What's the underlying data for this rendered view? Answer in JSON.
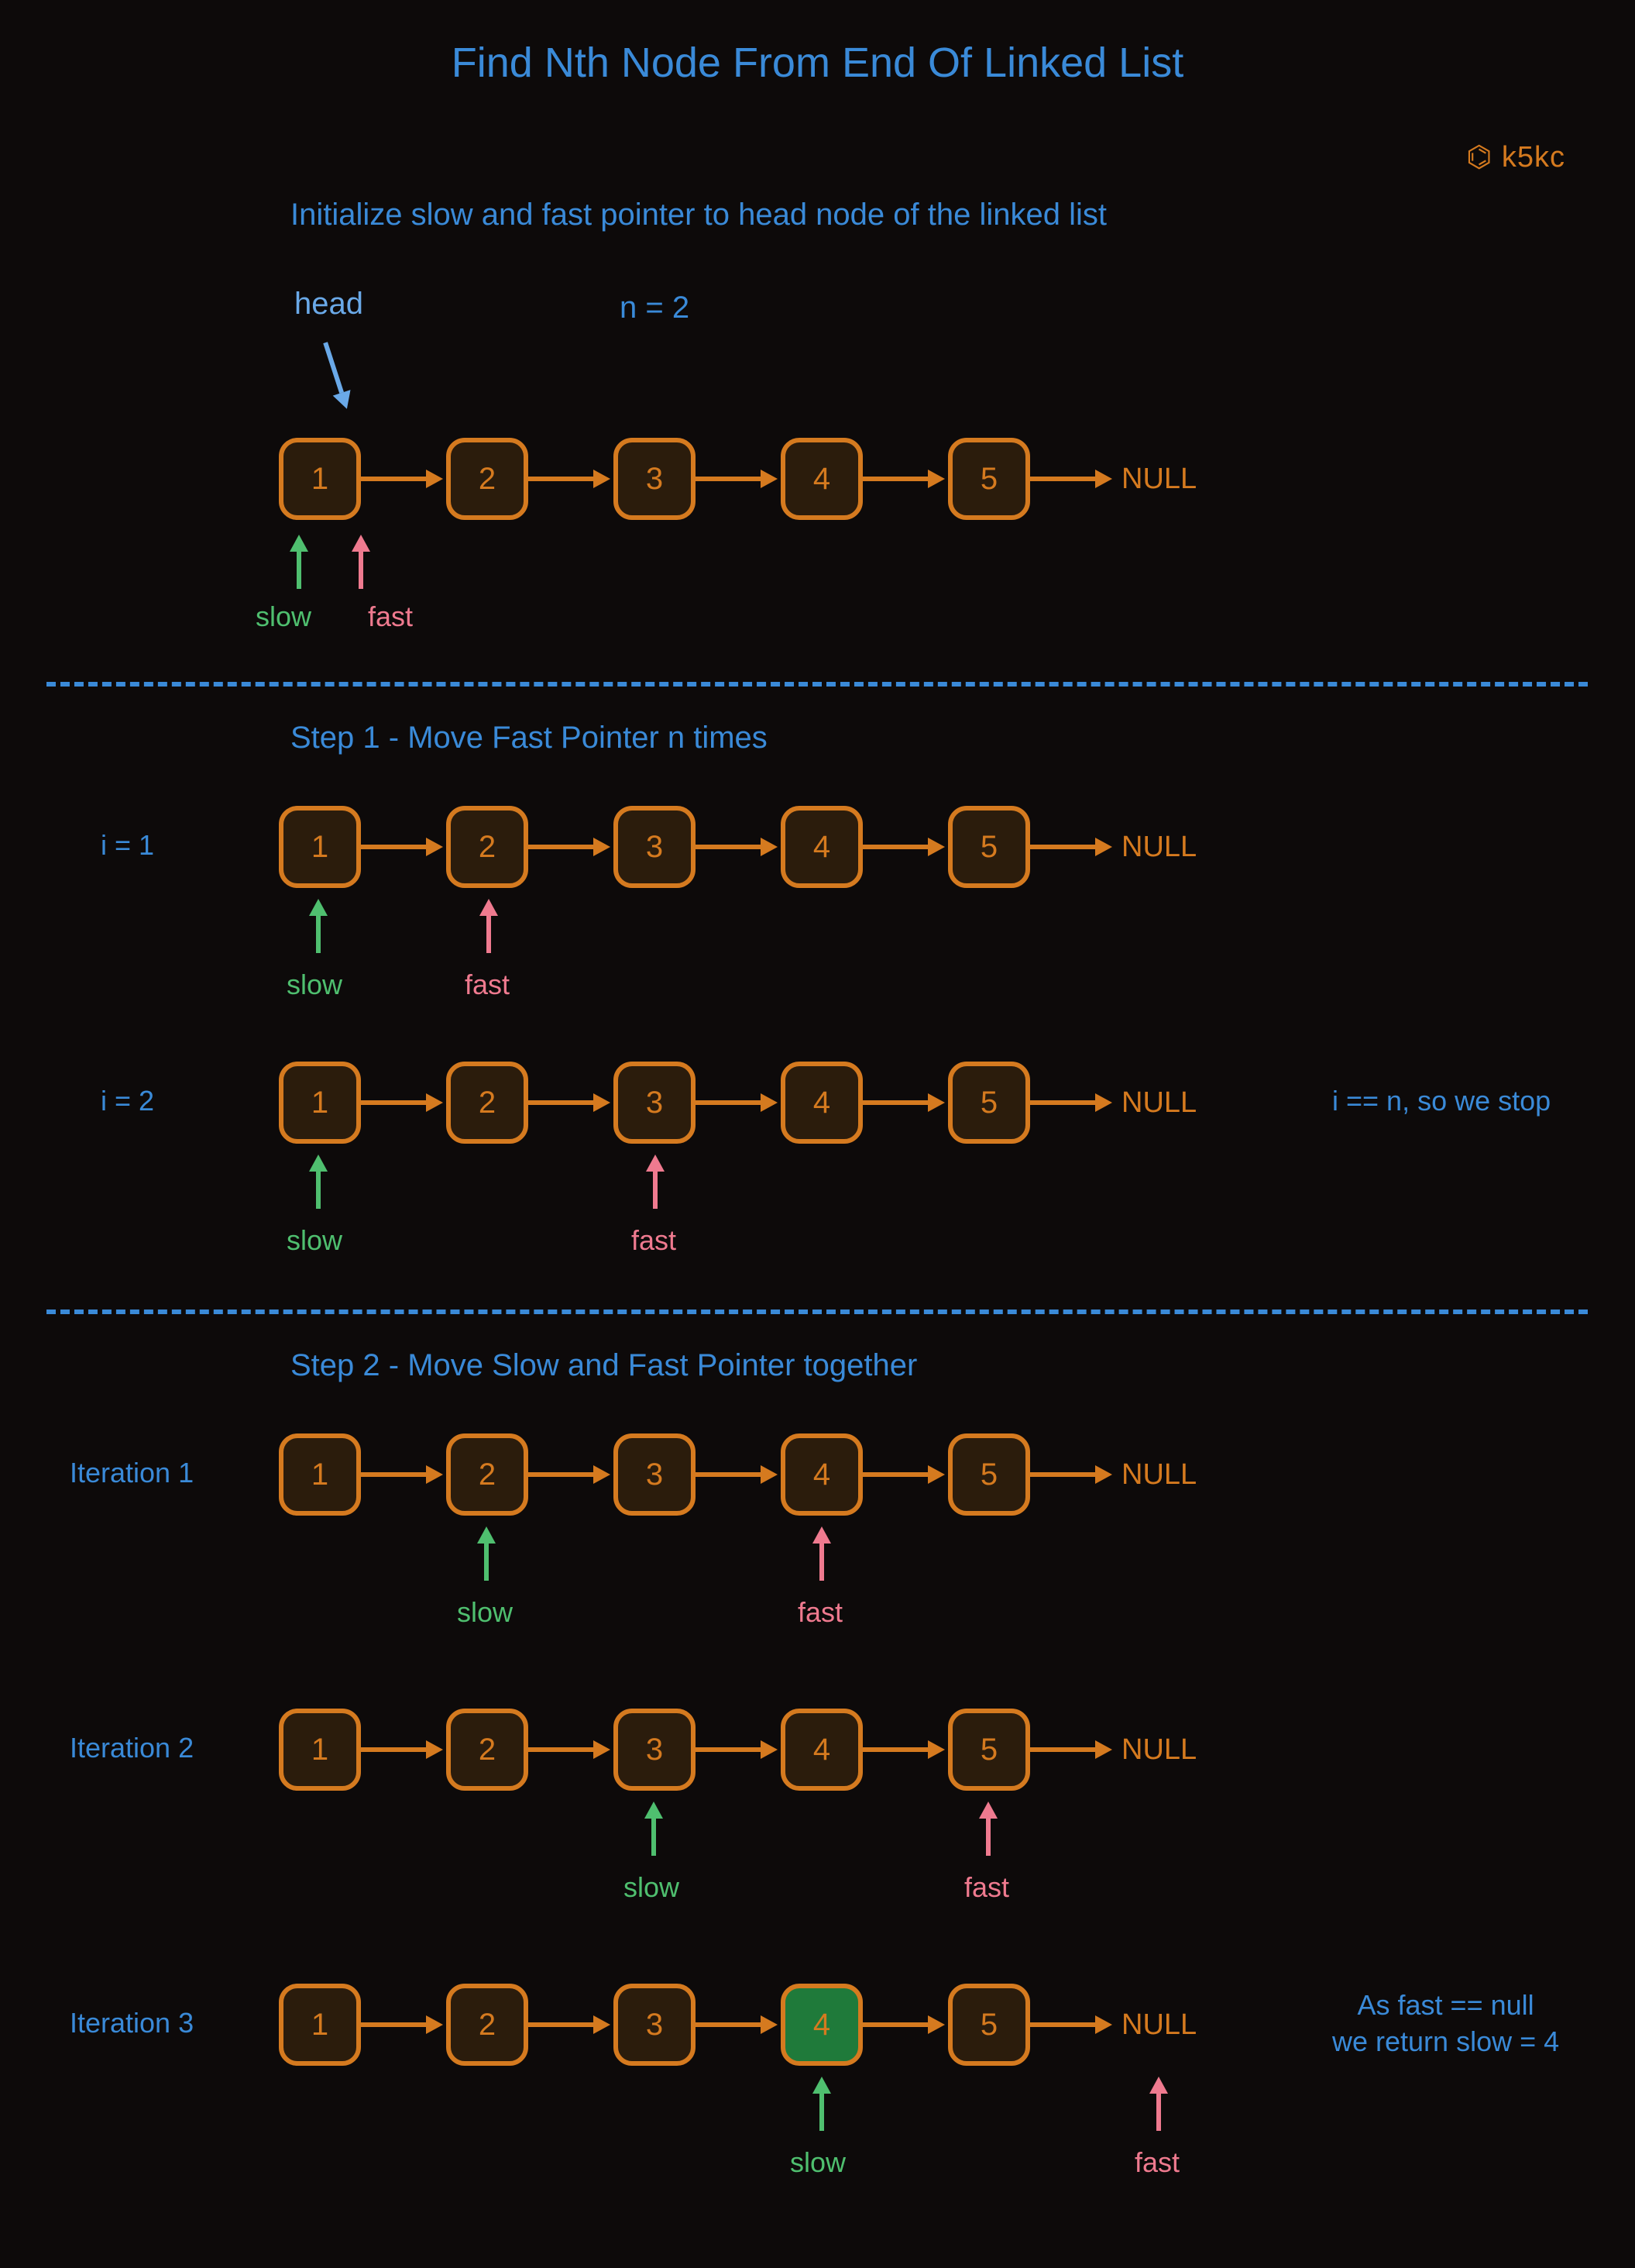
{
  "title": "Find Nth Node From End Of Linked List",
  "watermark": "⌬ k5kc",
  "intro": "Initialize slow and fast pointer to head node of the linked list",
  "head_label": "head",
  "n_label": "n = 2",
  "null_label": "NULL",
  "slow_label": "slow",
  "fast_label": "fast",
  "step1_title": "Step 1 - Move Fast Pointer n times",
  "step2_title": "Step 2 - Move Slow and Fast Pointer together",
  "i1": "i = 1",
  "i2": "i = 2",
  "stop_note": "i == n, so we stop",
  "it1": "Iteration 1",
  "it2": "Iteration 2",
  "it3": "Iteration 3",
  "final_note_l1": "As fast == null",
  "final_note_l2": "we return slow = 4",
  "nodes": [
    "1",
    "2",
    "3",
    "4",
    "5"
  ]
}
